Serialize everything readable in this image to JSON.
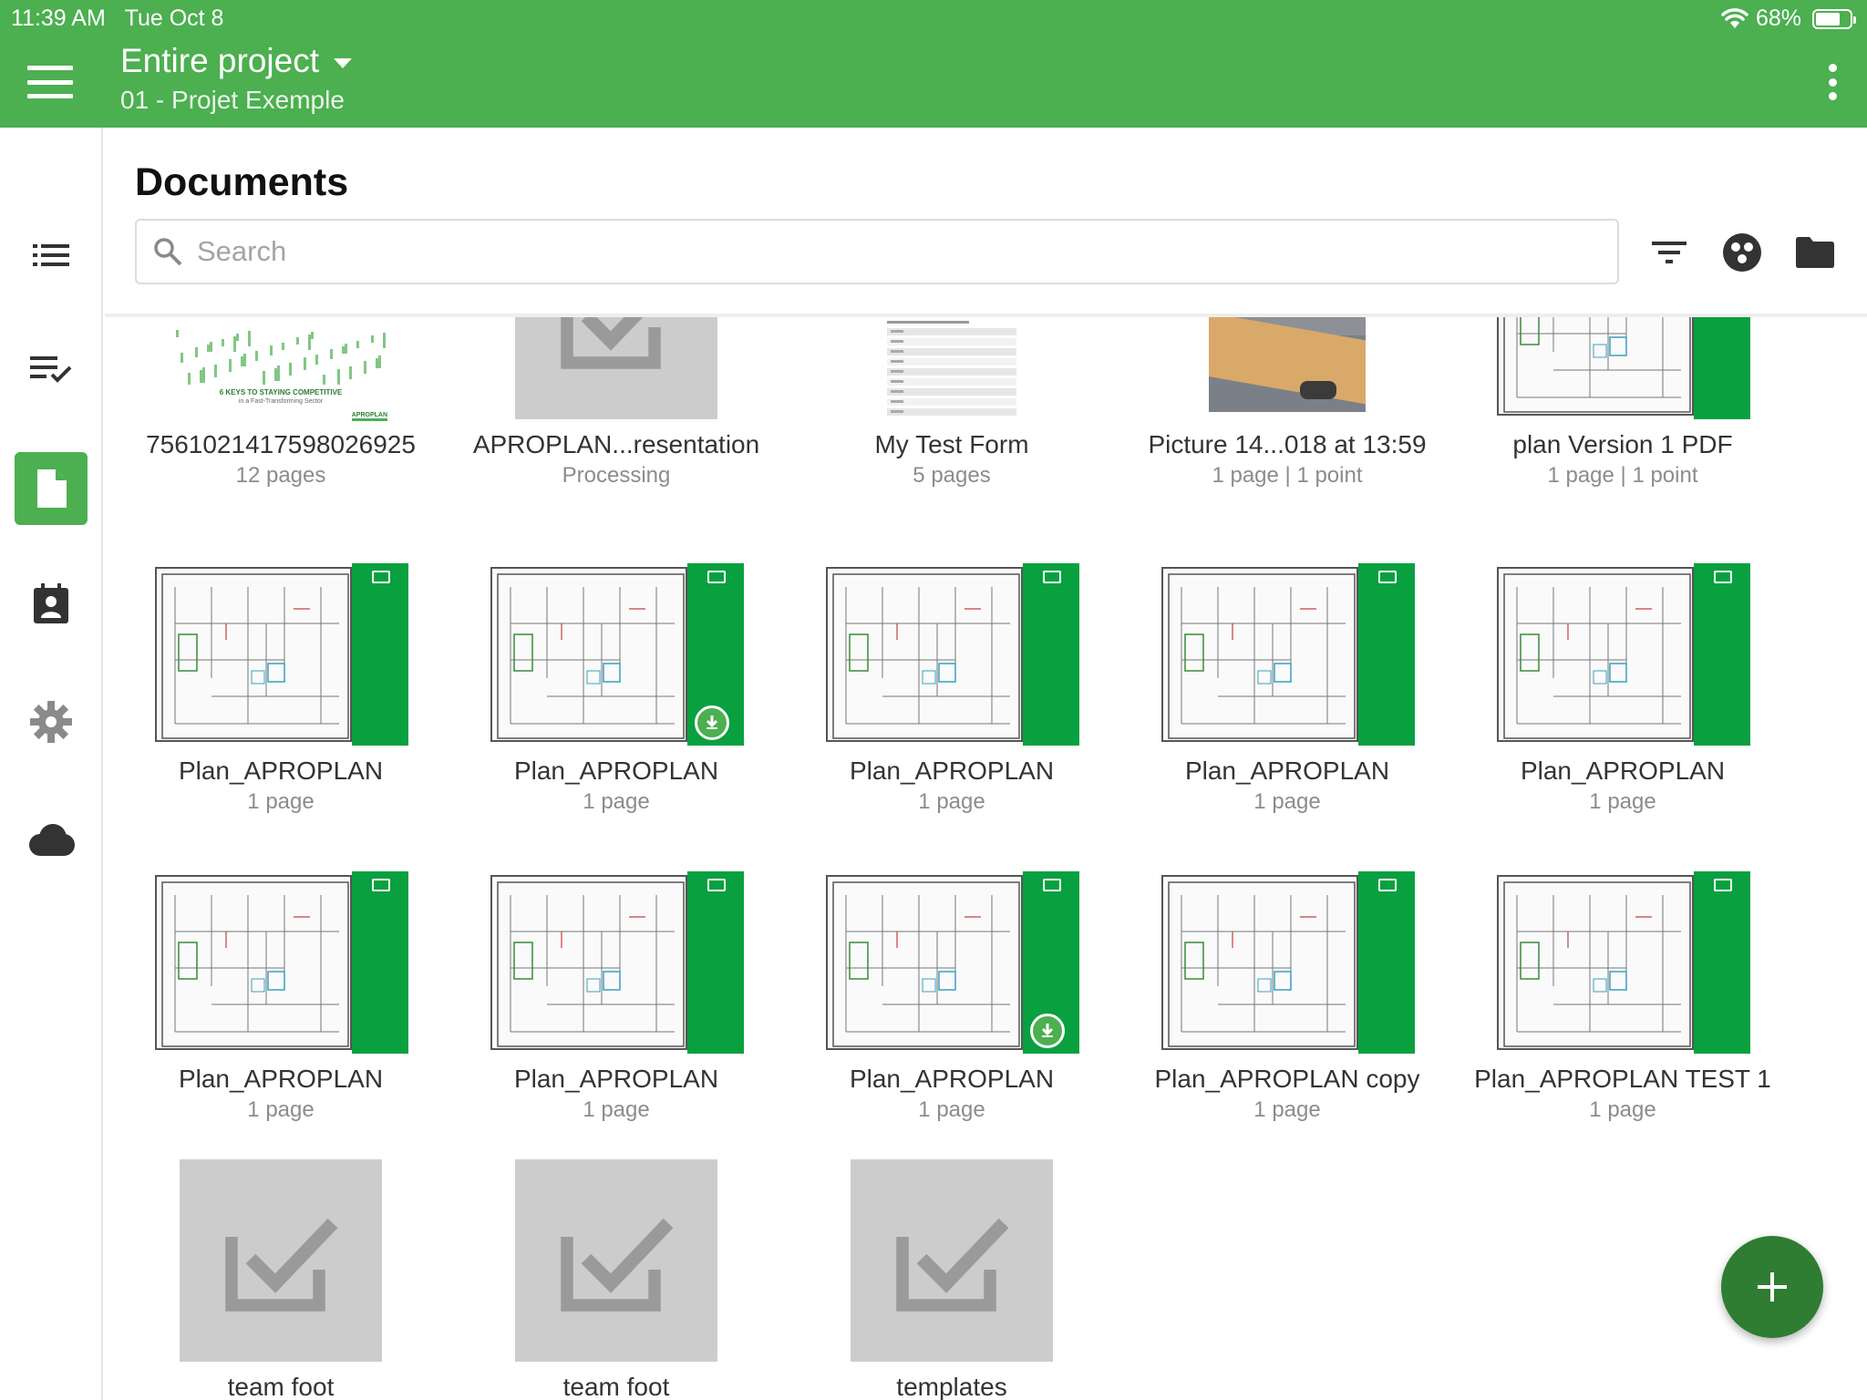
{
  "status_bar": {
    "time": "11:39 AM",
    "date": "Tue Oct 8",
    "battery": "68%",
    "battery_level": 0.68
  },
  "app_bar": {
    "title": "Entire project",
    "subtitle": "01 - Projet Exemple"
  },
  "page": {
    "title": "Documents"
  },
  "search": {
    "placeholder": "Search",
    "value": ""
  },
  "sidebar": {
    "items": [
      {
        "icon": "list-icon",
        "active": false
      },
      {
        "icon": "checklist-icon",
        "active": false
      },
      {
        "icon": "document-icon",
        "active": true
      },
      {
        "icon": "contact-calendar-icon",
        "active": false
      },
      {
        "icon": "gear-icon",
        "active": false
      },
      {
        "icon": "cloud-icon",
        "active": false
      }
    ]
  },
  "toolbar": {
    "icons": [
      "filter-icon",
      "groups-icon",
      "folder-icon"
    ]
  },
  "colors": {
    "brand": "#4caf50",
    "fab": "#2e7d32",
    "plan_band": "#09a040",
    "placeholder": "#cccccc"
  },
  "thumb_texts": {
    "booklet_headline": "6 KEYS TO STAYING COMPETITIVE",
    "booklet_sub": "in a Fast-Transforming Sector",
    "booklet_logo": "APROPLAN"
  },
  "documents": [
    {
      "name": "7561021417598026925",
      "meta": "12 pages",
      "thumb": "booklet"
    },
    {
      "name": "APROPLAN...resentation",
      "meta": "Processing",
      "thumb": "placeholder"
    },
    {
      "name": "My Test Form",
      "meta": "5 pages",
      "thumb": "form"
    },
    {
      "name": "Picture 14...018 at 13:59",
      "meta": "1 page | 1 point",
      "thumb": "photo"
    },
    {
      "name": "plan Version 1 PDF",
      "meta": "1 page | 1 point",
      "thumb": "plan"
    },
    {
      "name": "Plan_APROPLAN",
      "meta": "1 page",
      "thumb": "plan"
    },
    {
      "name": "Plan_APROPLAN",
      "meta": "1 page",
      "thumb": "plan",
      "synced": true
    },
    {
      "name": "Plan_APROPLAN",
      "meta": "1 page",
      "thumb": "plan"
    },
    {
      "name": "Plan_APROPLAN",
      "meta": "1 page",
      "thumb": "plan"
    },
    {
      "name": "Plan_APROPLAN",
      "meta": "1 page",
      "thumb": "plan"
    },
    {
      "name": "Plan_APROPLAN",
      "meta": "1 page",
      "thumb": "plan"
    },
    {
      "name": "Plan_APROPLAN",
      "meta": "1 page",
      "thumb": "plan"
    },
    {
      "name": "Plan_APROPLAN",
      "meta": "1 page",
      "thumb": "plan",
      "synced": true
    },
    {
      "name": "Plan_APROPLAN copy",
      "meta": "1 page",
      "thumb": "plan"
    },
    {
      "name": "Plan_APROPLAN TEST 1",
      "meta": "1 page",
      "thumb": "plan"
    },
    {
      "name": "team foot",
      "meta": "",
      "thumb": "placeholder"
    },
    {
      "name": "team foot",
      "meta": "",
      "thumb": "placeholder"
    },
    {
      "name": "templates",
      "meta": "",
      "thumb": "placeholder"
    }
  ],
  "fab": {
    "icon": "plus-icon"
  }
}
